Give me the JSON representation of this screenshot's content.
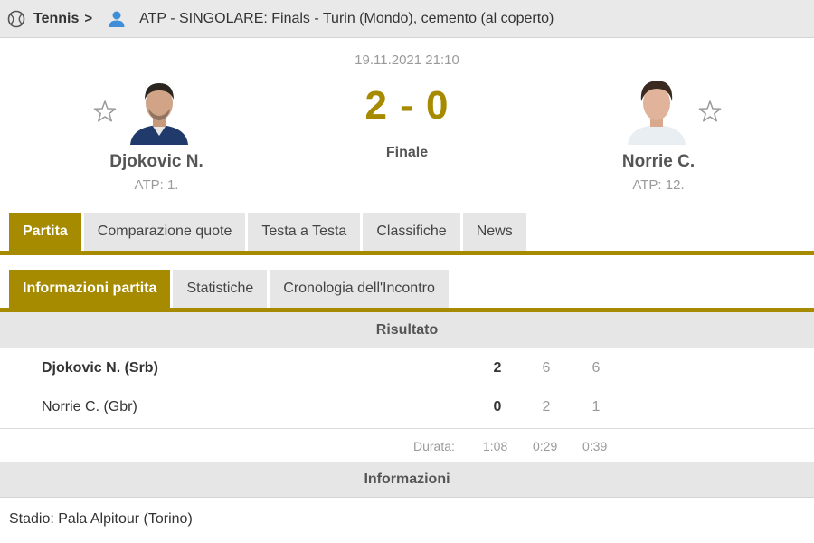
{
  "breadcrumb": {
    "sport": "Tennis",
    "chevron": ">",
    "tournament": "ATP - SINGOLARE: Finals - Turin (Mondo), cemento (al coperto)"
  },
  "match": {
    "datetime": "19.11.2021 21:10",
    "score": "2 - 0",
    "status": "Finale"
  },
  "home": {
    "name": "Djokovic N.",
    "rank": "ATP: 1."
  },
  "away": {
    "name": "Norrie C.",
    "rank": "ATP: 12."
  },
  "tabs": [
    {
      "label": "Partita",
      "active": true
    },
    {
      "label": "Comparazione quote",
      "active": false
    },
    {
      "label": "Testa a Testa",
      "active": false
    },
    {
      "label": "Classifiche",
      "active": false
    },
    {
      "label": "News",
      "active": false
    }
  ],
  "subtabs": [
    {
      "label": "Informazioni partita",
      "active": true
    },
    {
      "label": "Statistiche",
      "active": false
    },
    {
      "label": "Cronologia dell'Incontro",
      "active": false
    }
  ],
  "result": {
    "heading": "Risultato",
    "rows": [
      {
        "player": "Djokovic N. (Srb)",
        "total": "2",
        "sets": [
          "6",
          "6"
        ],
        "winner": true
      },
      {
        "player": "Norrie C. (Gbr)",
        "total": "0",
        "sets": [
          "2",
          "1"
        ],
        "winner": false
      }
    ],
    "duration_label": "Durata:",
    "durations": [
      "1:08",
      "0:29",
      "0:39"
    ]
  },
  "info": {
    "heading": "Informazioni",
    "stadium": "Stadio: Pala Alpitour (Torino)"
  },
  "colors": {
    "accent": "#a68a00",
    "tab_bg": "#e6e6e6",
    "header_bg": "#e9e9e9",
    "person_icon": "#3f8fd8"
  },
  "icons": {
    "sport": "tennis-ball-icon",
    "person": "person-icon",
    "favorite": "star-outline-icon"
  }
}
